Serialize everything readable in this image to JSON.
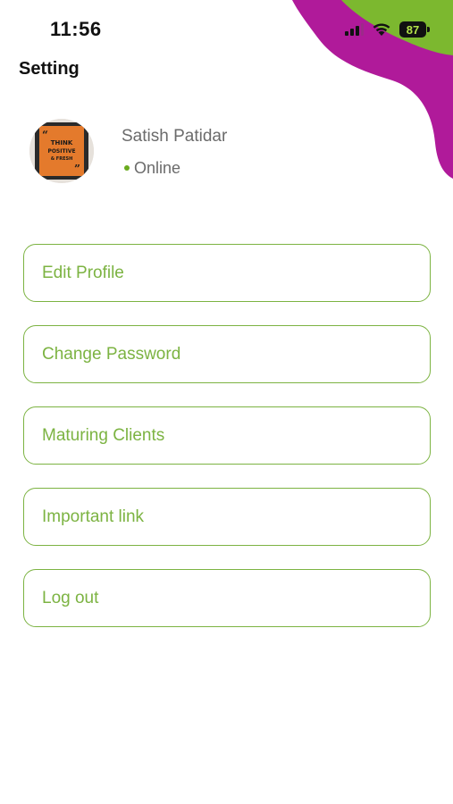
{
  "status_bar": {
    "time": "11:56",
    "battery": "87",
    "icons": [
      "signal-icon",
      "wifi-icon",
      "battery-icon"
    ]
  },
  "header": {
    "title": "Setting"
  },
  "profile": {
    "name": "Satish Patidar",
    "status": "Online",
    "status_color": "#6aab1e",
    "avatar": {
      "poster_lines": [
        "THINK",
        "POSITIVE",
        "& FRESH"
      ]
    }
  },
  "menu": {
    "items": [
      {
        "label": "Edit Profile"
      },
      {
        "label": "Change Password"
      },
      {
        "label": "Maturing Clients"
      },
      {
        "label": "Important link"
      },
      {
        "label": "Log out"
      }
    ]
  },
  "colors": {
    "accent": "#7cb342",
    "decoration_green": "#7cb82f",
    "decoration_purple": "#b01a9a",
    "text_dark": "#111111",
    "text_gray": "#6b6b6b"
  }
}
